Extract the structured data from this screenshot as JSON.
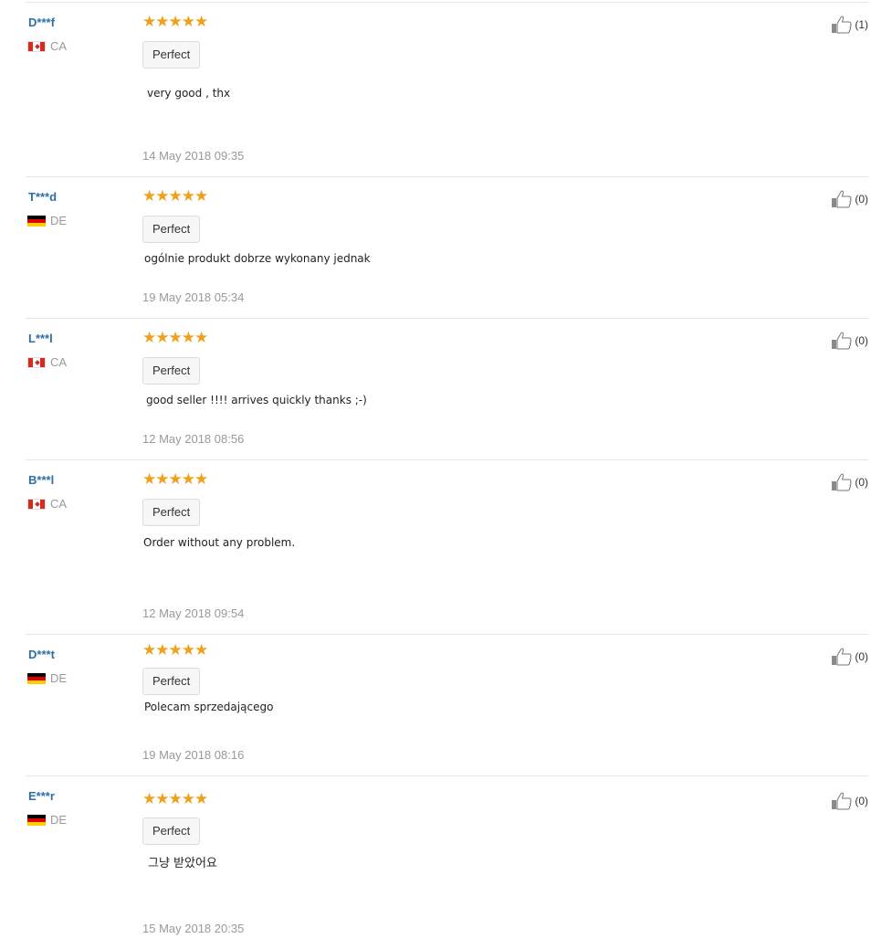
{
  "reviews": [
    {
      "user": "D***f",
      "country": "CA",
      "flag": "ca",
      "stars": "★★★★★",
      "tag": "Perfect",
      "text": "very good , thx",
      "date": "14 May 2018 09:35",
      "helpful": "(1)"
    },
    {
      "user": "T***d",
      "country": "DE",
      "flag": "de",
      "stars": "★★★★★",
      "tag": "Perfect",
      "text": "ogólnie produkt dobrze wykonany jednak",
      "date": "19 May 2018 05:34",
      "helpful": "(0)"
    },
    {
      "user": "L***l",
      "country": "CA",
      "flag": "ca",
      "stars": "★★★★★",
      "tag": "Perfect",
      "text": "good seller !!!! arrives quickly thanks ;-)",
      "date": "12 May 2018 08:56",
      "helpful": "(0)"
    },
    {
      "user": "B***l",
      "country": "CA",
      "flag": "ca",
      "stars": "★★★★★",
      "tag": "Perfect",
      "text": "Order without any problem.",
      "date": "12 May 2018 09:54",
      "helpful": "(0)"
    },
    {
      "user": "D***t",
      "country": "DE",
      "flag": "de",
      "stars": "★★★★★",
      "tag": "Perfect",
      "text": "Polecam sprzedającego",
      "date": "19 May 2018 08:16",
      "helpful": "(0)"
    },
    {
      "user": "E***r",
      "country": "DE",
      "flag": "de",
      "stars": "★★★★★",
      "tag": "Perfect",
      "text": "그냥 받았어요",
      "date": "15 May 2018 20:35",
      "helpful": "(0)"
    }
  ],
  "colors": {
    "star": "#f0a01a",
    "username": "#2f6ea5",
    "muted": "#999999"
  },
  "icons": {
    "helpful": "thumbs-up-icon",
    "country": "flag-icon"
  }
}
